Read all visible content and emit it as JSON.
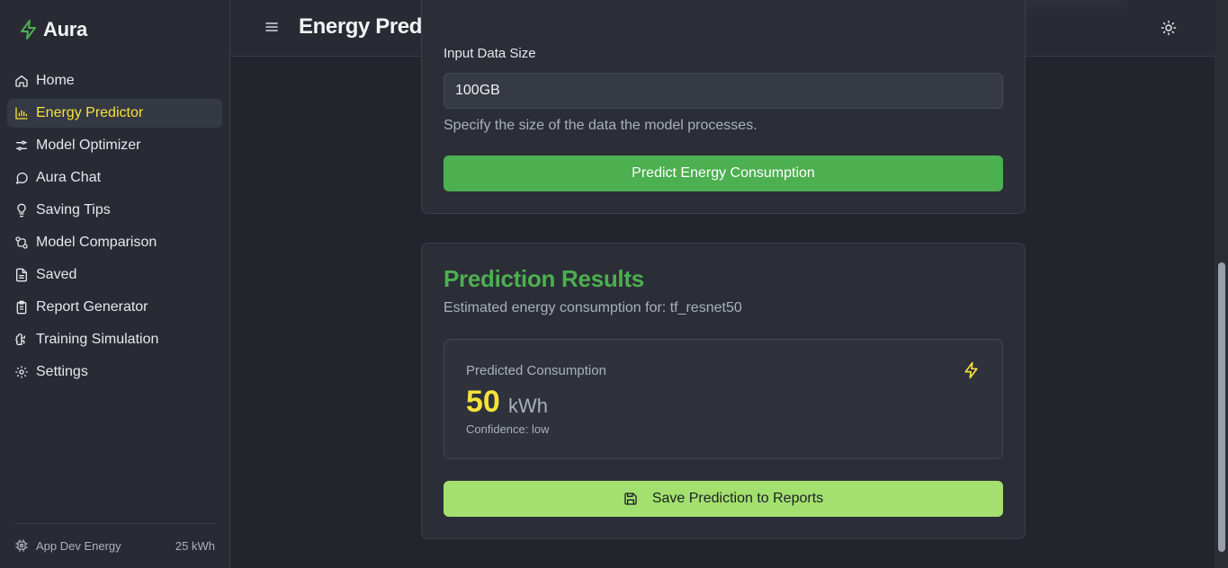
{
  "app": {
    "name": "Aura"
  },
  "header": {
    "title": "Energy Predictor"
  },
  "sidebar": {
    "items": [
      {
        "label": "Home",
        "icon": "home-icon",
        "active": false
      },
      {
        "label": "Energy Predictor",
        "icon": "bar-chart-icon",
        "active": true
      },
      {
        "label": "Model Optimizer",
        "icon": "sliders-icon",
        "active": false
      },
      {
        "label": "Aura Chat",
        "icon": "chat-bubble-icon",
        "active": false
      },
      {
        "label": "Saving Tips",
        "icon": "lightbulb-icon",
        "active": false
      },
      {
        "label": "Model Comparison",
        "icon": "compare-icon",
        "active": false
      },
      {
        "label": "Saved",
        "icon": "document-icon",
        "active": false
      },
      {
        "label": "Report Generator",
        "icon": "clipboard-icon",
        "active": false
      },
      {
        "label": "Training Simulation",
        "icon": "brain-icon",
        "active": false
      },
      {
        "label": "Settings",
        "icon": "gear-icon",
        "active": false
      }
    ],
    "footer": {
      "label": "App Dev Energy",
      "value": "25 kWh",
      "icon": "cpu-icon"
    }
  },
  "form": {
    "field_label": "Input Data Size",
    "data_size_value": "100GB",
    "helper": "Specify the size of the data the model processes.",
    "predict_label": "Predict Energy Consumption"
  },
  "results": {
    "title": "Prediction Results",
    "subtitle_prefix": "Estimated energy consumption for:",
    "model": "tf_resnet50",
    "metric_label": "Predicted Consumption",
    "value": "50",
    "unit": "kWh",
    "confidence": "Confidence: low",
    "save_label": "Save Prediction to Reports"
  },
  "colors": {
    "accent_green": "#4caf50",
    "accent_yellow": "#f5e23a",
    "save_button": "#a3e06f",
    "background": "#22252c"
  }
}
